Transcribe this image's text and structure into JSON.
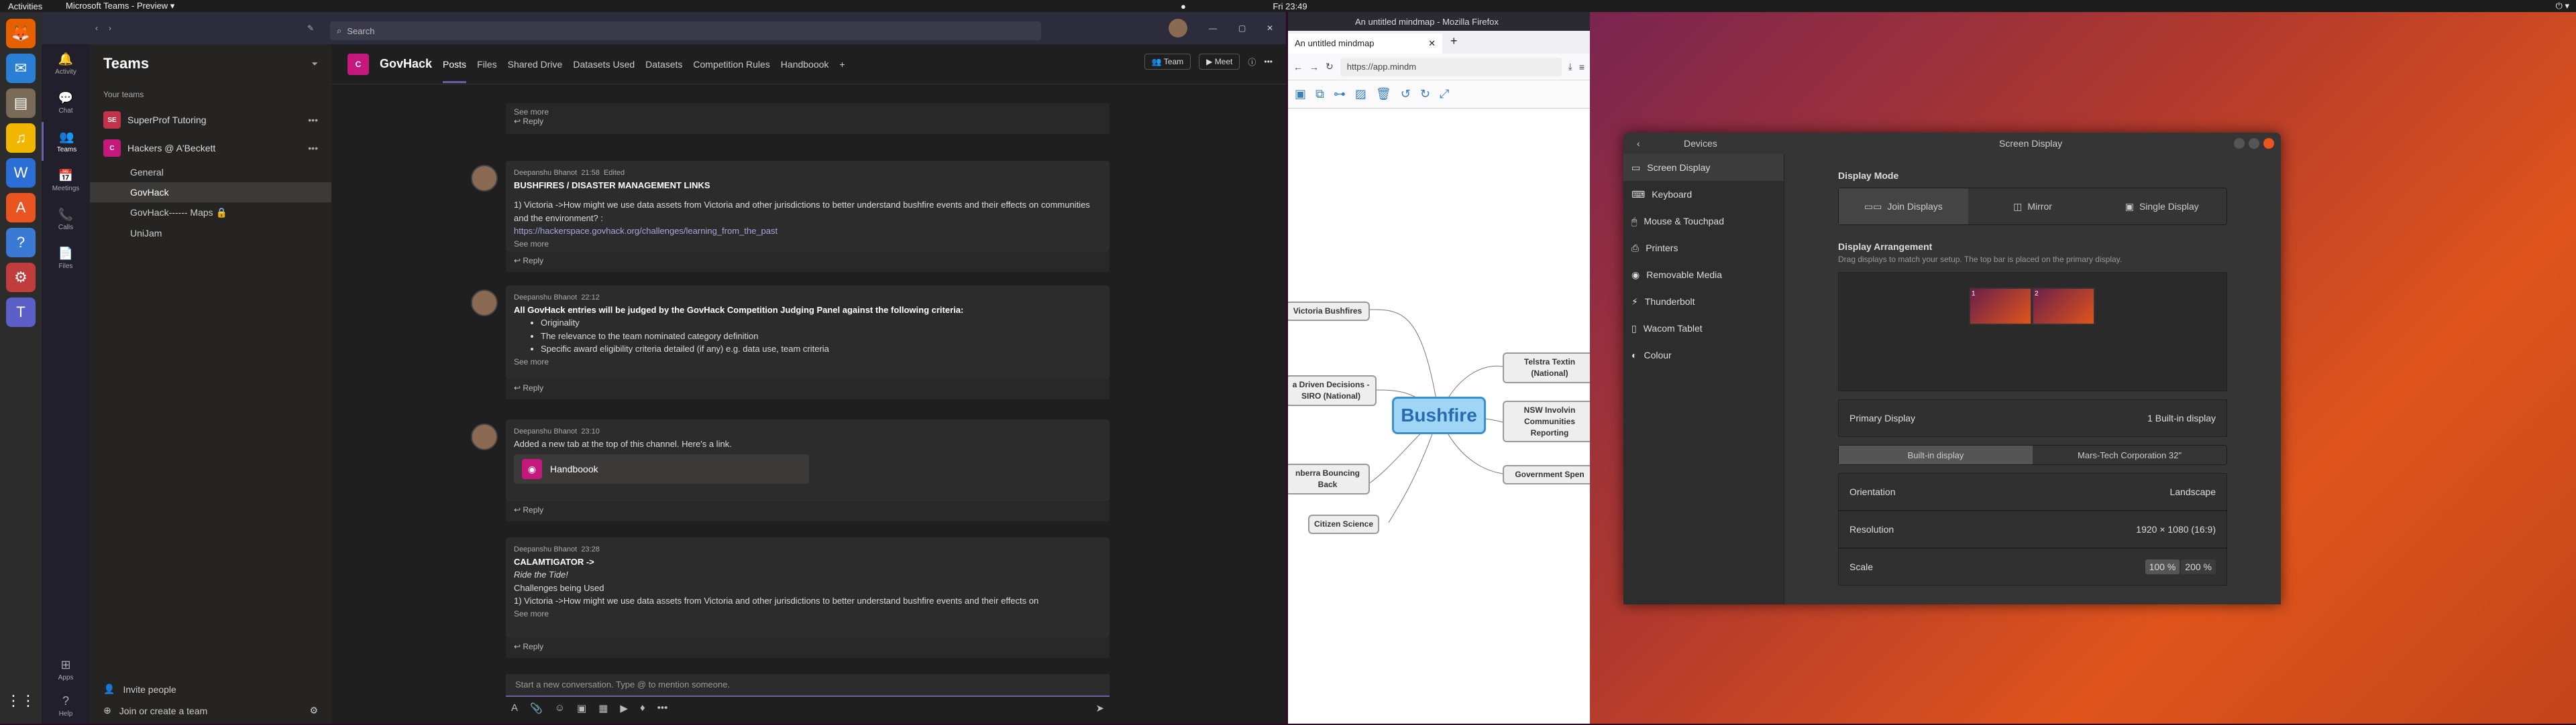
{
  "topbar": {
    "activities": "Activities",
    "app_menu": "Microsoft Teams - Preview ▾",
    "clock": "Fri 23:49"
  },
  "teams": {
    "search_placeholder": "Search",
    "rail": [
      {
        "label": "Activity",
        "icon": "bell-icon"
      },
      {
        "label": "Chat",
        "icon": "chat-icon"
      },
      {
        "label": "Teams",
        "icon": "teams-icon"
      },
      {
        "label": "Meetings",
        "icon": "calendar-icon"
      },
      {
        "label": "Calls",
        "icon": "phone-icon"
      },
      {
        "label": "Files",
        "icon": "file-icon"
      }
    ],
    "rail_bottom": [
      {
        "label": "Apps"
      },
      {
        "label": "Help"
      }
    ],
    "list_title": "Teams",
    "your_teams": "Your teams",
    "team1": {
      "abbr": "SE",
      "name": "SuperProf Tutoring"
    },
    "team2": {
      "abbr": "C",
      "name": "Hackers @ A'Beckett"
    },
    "channels": [
      "General",
      "GovHack",
      "GovHack------ Maps",
      "UniJam"
    ],
    "invite": "Invite people",
    "join": "Join or create a team",
    "channel": {
      "abbr": "C",
      "name": "GovHack"
    },
    "tabs": [
      "Posts",
      "Files",
      "Shared Drive",
      "Datasets Used",
      "Datasets",
      "Competition Rules",
      "Handboook"
    ],
    "team_btn": "Team",
    "meet_btn": "Meet",
    "see_more": "See more",
    "reply": "Reply",
    "messages": [
      {
        "author": "Deepanshu Bhanot",
        "time": "21:58",
        "edited": "Edited",
        "subject": "BUSHFIRES /  DISASTER MANAGEMENT LINKS",
        "body": "1) Victoria ->How might we use data assets from Victoria and other jurisdictions to better understand bushfire events and their effects on communities and the environment? :",
        "link": "https://hackerspace.govhack.org/challenges/learning_from_the_past"
      },
      {
        "author": "Deepanshu Bhanot",
        "time": "22:12",
        "subject": "All GovHack entries will be judged by the GovHack Competition Judging Panel against the following criteria:",
        "bullets": [
          "Originality",
          "The relevance to the team nominated category definition",
          "Specific award eligibility criteria detailed (if any) e.g. data use, team criteria"
        ]
      },
      {
        "author": "Deepanshu Bhanot",
        "time": "23:10",
        "body": "Added a new tab at the top of this channel. Here's a link.",
        "card": "Handboook"
      },
      {
        "author": "Deepanshu Bhanot",
        "time": "23:28",
        "subject": "CALAMTIGATOR ->",
        "italic": "Ride the Tide!",
        "l2": "Challenges being Used",
        "body": "1) Victoria ->How might we use data assets from Victoria and other jurisdictions to better understand bushfire events and their effects on"
      }
    ],
    "compose_placeholder": "Start a new conversation. Type @ to mention someone."
  },
  "firefox": {
    "title": "An untitled mindmap - Mozilla Firefox",
    "tab": "An untitled mindmap",
    "url": "https://app.mindm",
    "central": "Bushfire",
    "nodes": {
      "n1": "Victoria Bushfires",
      "n2": "a Driven Decisions -\nSIRO (National)",
      "n3": "nberra Bouncing\nBack",
      "n4": "Citizen Science",
      "n5": "Telstra Textin\n(National)",
      "n6": "NSW Involvin\nCommunities\nReporting",
      "n7": "Government Spen"
    }
  },
  "settings": {
    "header_left": "Devices",
    "header_title": "Screen Display",
    "sidebar": [
      "Screen Display",
      "Keyboard",
      "Mouse & Touchpad",
      "Printers",
      "Removable Media",
      "Thunderbolt",
      "Wacom Tablet",
      "Colour"
    ],
    "display_mode": "Display Mode",
    "modes": [
      "Join Displays",
      "Mirror",
      "Single Display"
    ],
    "arrangement": "Display Arrangement",
    "arrangement_hint": "Drag displays to match your setup. The top bar is placed on the primary display.",
    "disp1": "1",
    "disp2": "2",
    "primary_label": "Primary Display",
    "primary_value": "1   Built-in display",
    "tab_builtin": "Built-in display",
    "tab_mars": "Mars-Tech Corporation 32\"",
    "orientation_label": "Orientation",
    "orientation_value": "Landscape",
    "resolution_label": "Resolution",
    "resolution_value": "1920 × 1080 (16:9)",
    "scale_label": "Scale",
    "scale_100": "100 %",
    "scale_200": "200 %"
  }
}
